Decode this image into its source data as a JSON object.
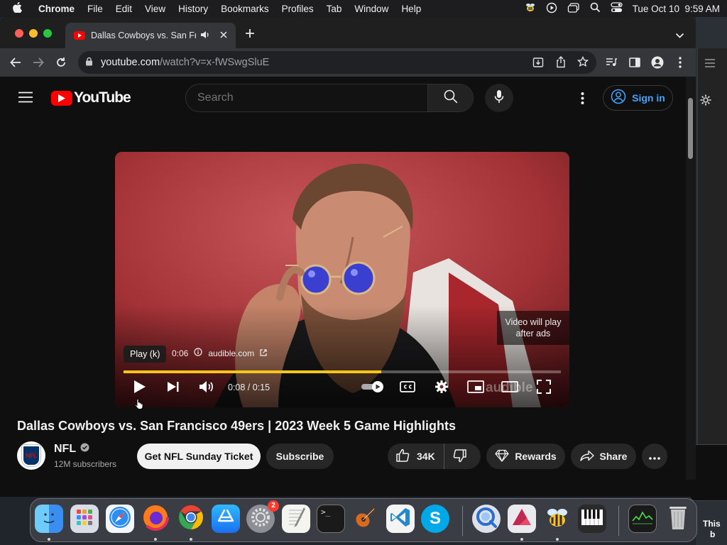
{
  "menubar": {
    "app": "Chrome",
    "items": [
      "File",
      "Edit",
      "View",
      "History",
      "Bookmarks",
      "Profiles",
      "Tab",
      "Window",
      "Help"
    ],
    "clock": "Tue Oct 10  9:59 AM"
  },
  "browser": {
    "tab_title": "Dallas Cowboys vs. San Fr",
    "url_host": "youtube.com",
    "url_path": "/watch?v=x-fWSwgSluE"
  },
  "youtube": {
    "logo_text": "YouTube",
    "search_placeholder": "Search",
    "sign_in": "Sign in"
  },
  "player": {
    "tooltip": "Play (k)",
    "ad_time": "0:06",
    "ad_domain": "audible.com",
    "ads_notice_line1": "Video will play",
    "ads_notice_line2": "after ads",
    "time": "0:08 / 0:15",
    "watermark": "audible",
    "progress": 0.59
  },
  "video": {
    "title": "Dallas Cowboys vs. San Francisco 49ers | 2023 Week 5 Game Highlights",
    "channel": "NFL",
    "channel_logo": "NFL",
    "subscribers": "12M subscribers",
    "cta": "Get NFL Sunday Ticket",
    "subscribe": "Subscribe",
    "likes": "34K",
    "rewards": "Rewards",
    "share": "Share"
  },
  "desktop": {
    "side_text_1": "This",
    "side_text_2": "b"
  },
  "dock": {
    "settings_badge": "2",
    "terminal_prompt": ">_"
  },
  "colors": {
    "yt_red": "#ff0000",
    "progress_yellow": "#f5c518",
    "link_blue": "#3ea6ff"
  }
}
